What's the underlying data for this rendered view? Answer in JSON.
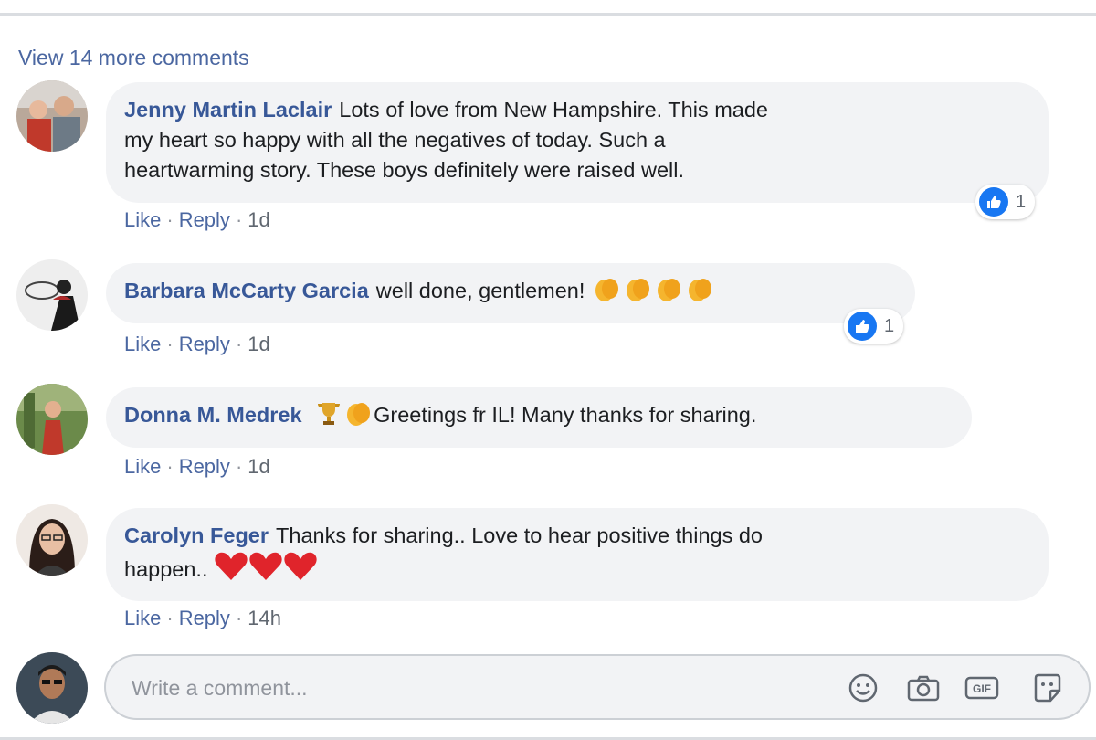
{
  "comments_section": {
    "view_more_label": "View 14 more comments"
  },
  "comments": [
    {
      "author": "Jenny Martin Laclair",
      "text_line1": "Lots of love from New Hampshire. This made",
      "text_line2": "my heart so happy with all the negatives of today. Such a",
      "text_line3": "heartwarming story. These boys definitely were raised well.",
      "like_label": "Like",
      "reply_label": "Reply",
      "time": "1d",
      "reaction_count": "1"
    },
    {
      "author": "Barbara McCarty Garcia",
      "text": "well done, gentlemen!",
      "like_label": "Like",
      "reply_label": "Reply",
      "time": "1d",
      "reaction_count": "1"
    },
    {
      "author": "Donna M. Medrek",
      "text": "Greetings fr IL! Many thanks for sharing.",
      "like_label": "Like",
      "reply_label": "Reply",
      "time": "1d"
    },
    {
      "author": "Carolyn Feger",
      "text_line1": "Thanks for sharing.. Love to hear positive things do",
      "text_line2": "happen..",
      "like_label": "Like",
      "reply_label": "Reply",
      "time": "14h"
    }
  ],
  "separator": "·",
  "composer": {
    "placeholder": "Write a comment...",
    "tools": [
      "emoji-icon",
      "camera-icon",
      "gif-icon",
      "sticker-icon"
    ]
  },
  "colors": {
    "author_link": "#385898",
    "bubble_bg": "#f2f3f5",
    "like_blue": "#1877f2",
    "heart_red": "#e0242b",
    "clap_yellow": "#f5b52e"
  }
}
